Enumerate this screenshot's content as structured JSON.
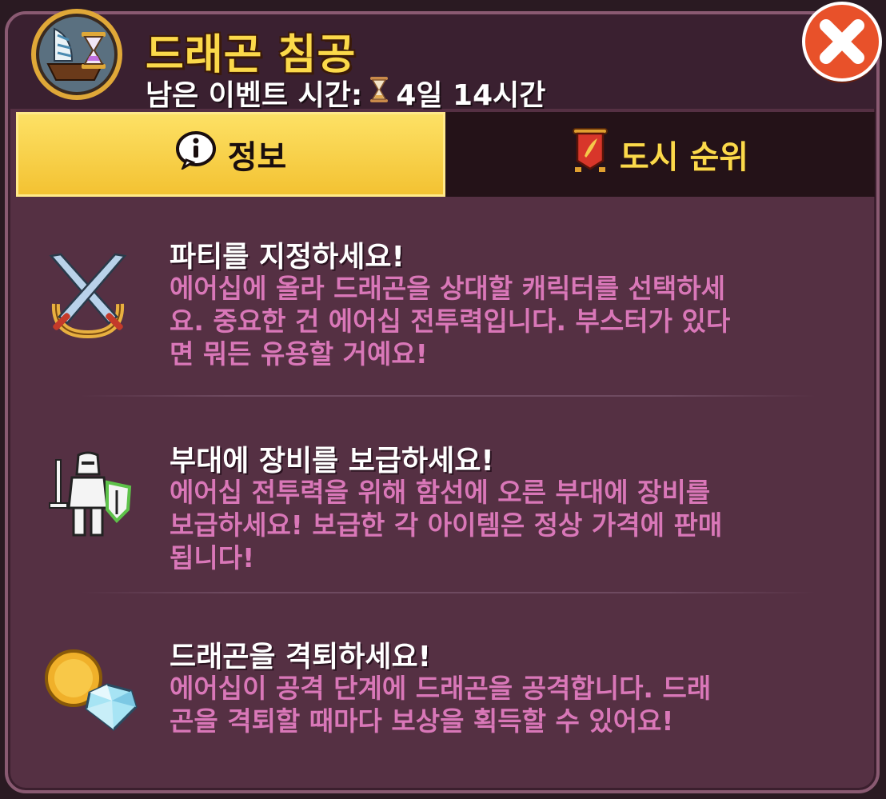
{
  "header": {
    "title": "드래곤 침공",
    "timer_label": "남은 이벤트 시간:",
    "timer_value": "4일 14시간"
  },
  "tabs": [
    {
      "label": "정보",
      "icon": "info-icon",
      "active": true
    },
    {
      "label": "도시 순위",
      "icon": "banner-icon",
      "active": false
    }
  ],
  "sections": [
    {
      "icon": "crossed-swords-icon",
      "heading": "파티를 지정하세요!",
      "desc_lines": [
        "에어십에 올라 드래곤을 상대할 캐릭터를 선택하세",
        "요. 중요한 건 에어십 전투력입니다. 부스터가 있다",
        "면 뭐든 유용할 거예요!"
      ]
    },
    {
      "icon": "knight-icon",
      "heading": "부대에 장비를 보급하세요!",
      "desc_lines": [
        "에어십 전투력을 위해 함선에 오른 부대에 장비를",
        "보급하세요! 보급한 각 아이템은 정상 가격에 판매",
        "됩니다!"
      ]
    },
    {
      "icon": "coin-gem-icon",
      "heading": "드래곤을 격퇴하세요!",
      "desc_lines": [
        "에어십이 공격 단계에 드래곤을 공격합니다. 드래",
        "곤을 격퇴할 때마다 보상을 획득할 수 있어요!"
      ]
    }
  ],
  "colors": {
    "title": "#fbd94a",
    "description": "#d977b8",
    "panel": "#553043",
    "active_tab": "#f7cd3f"
  }
}
